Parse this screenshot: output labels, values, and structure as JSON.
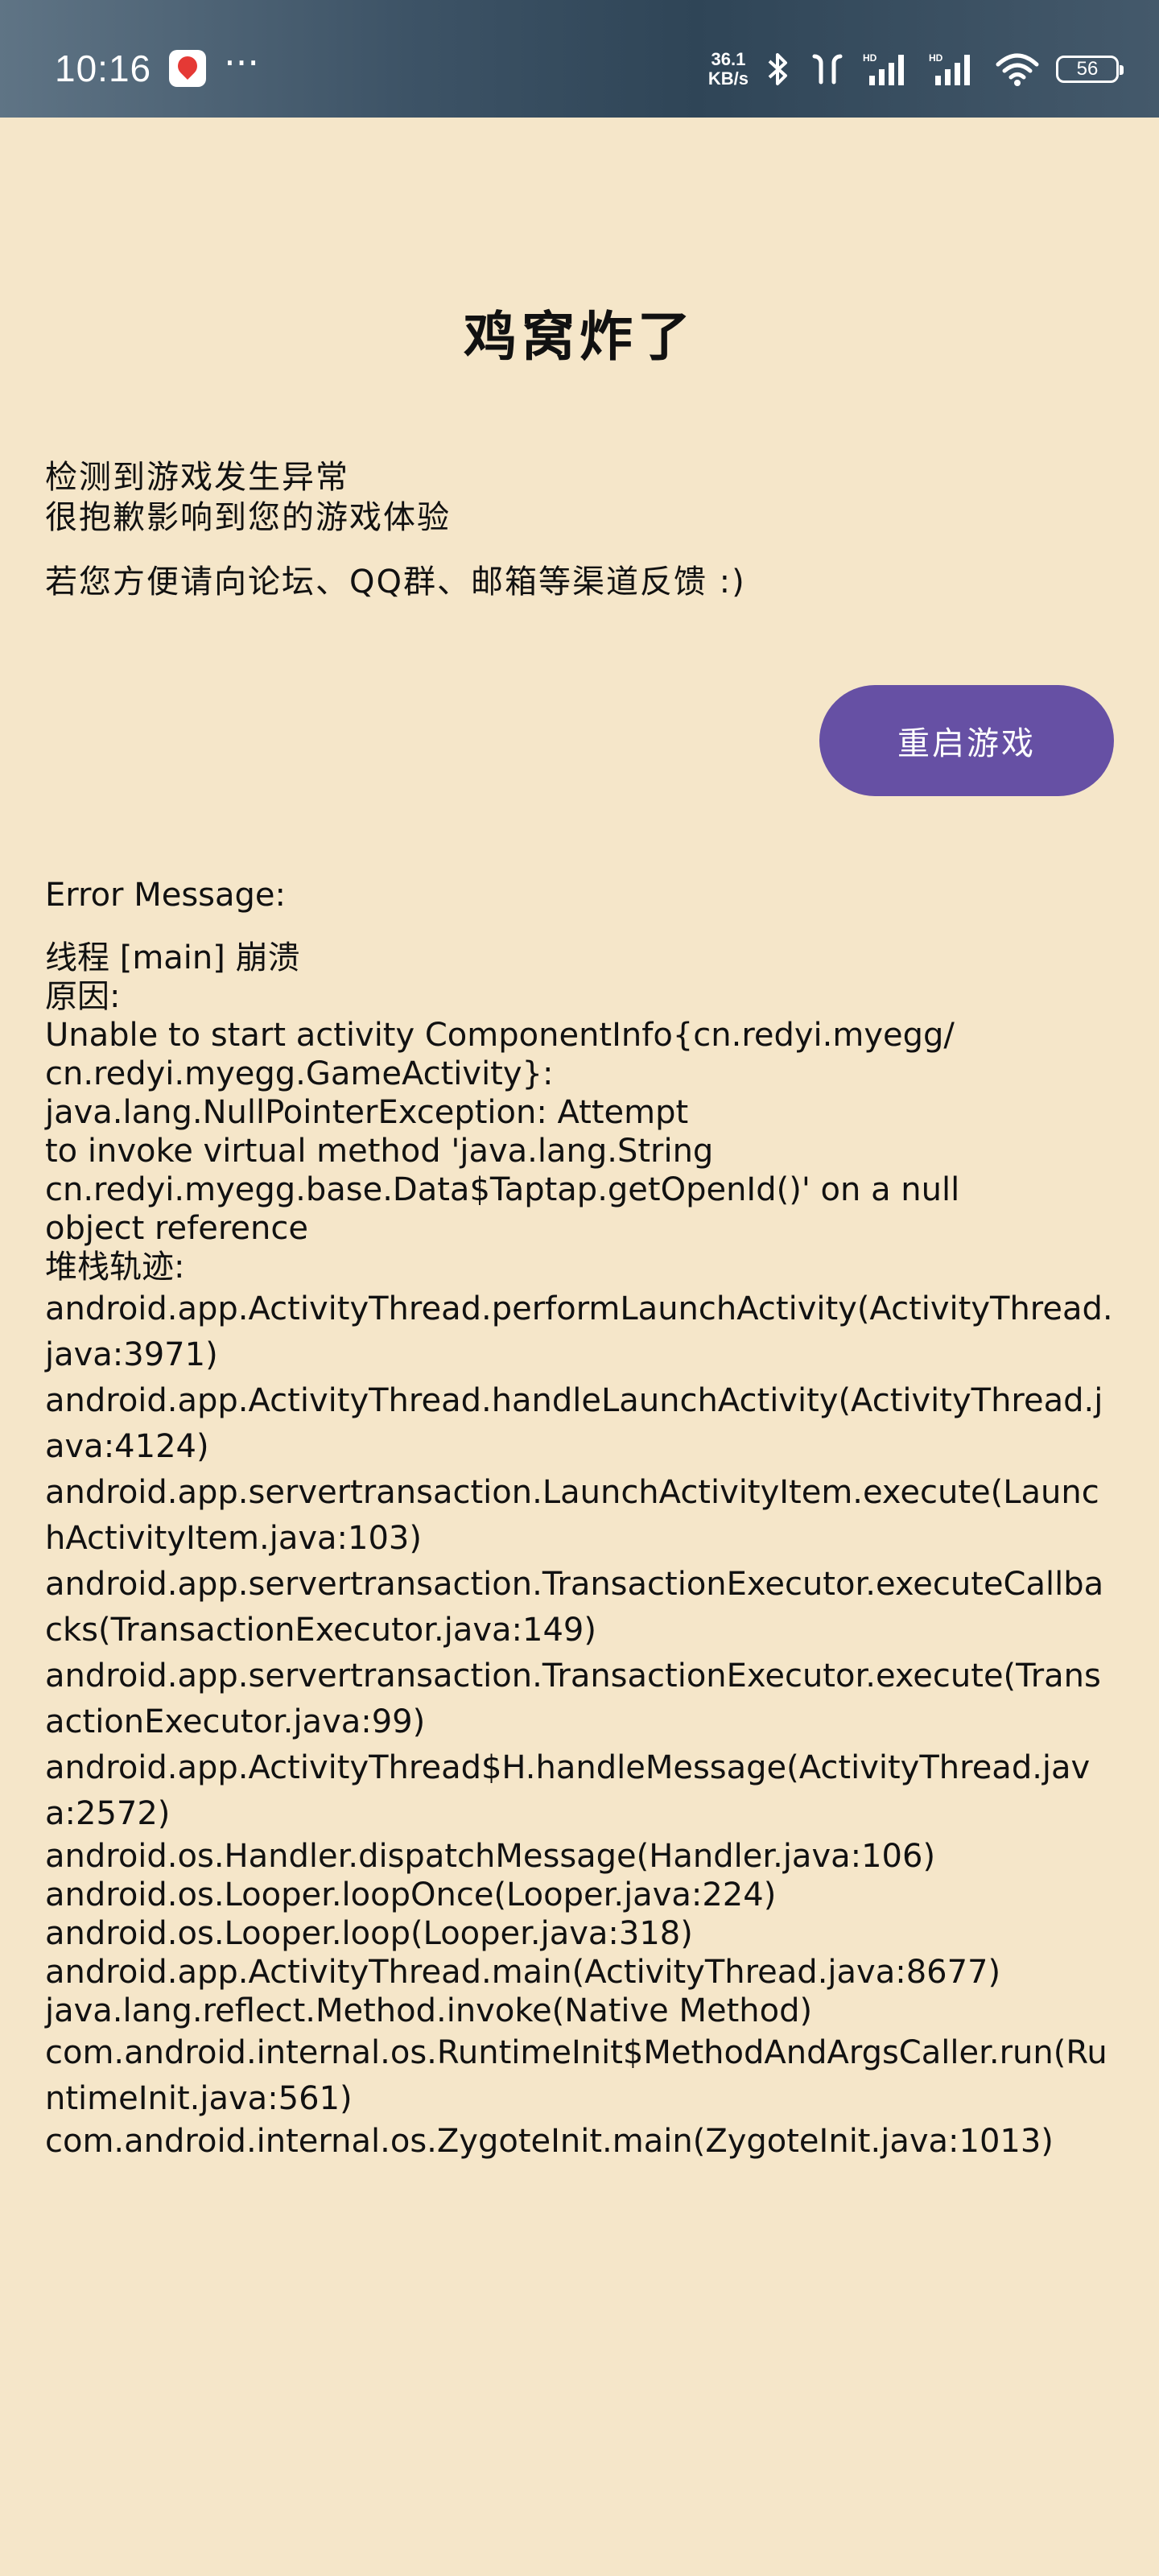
{
  "status_bar": {
    "time": "10:16",
    "more": "···",
    "net_speed_value": "36.1",
    "net_speed_unit": "KB/s",
    "battery": "56"
  },
  "title": "鸡窝炸了",
  "intro": {
    "line1": "检测到游戏发生异常",
    "line2": "很抱歉影响到您的游戏体验",
    "line3": "若您方便请向论坛、QQ群、邮箱等渠道反馈 :)"
  },
  "restart_button": "重启游戏",
  "error": {
    "label": "Error Message:",
    "thread_line": "线程 [main] 崩溃",
    "cause_label": "原因:",
    "cause_lines": [
      "Unable to start activity ComponentInfo{cn.redyi.myegg/",
      "cn.redyi.myegg.GameActivity}:",
      "java.lang.NullPointerException: Attempt",
      "to invoke virtual method 'java.lang.String",
      "cn.redyi.myegg.base.Data$Taptap.getOpenId()' on a null",
      "object reference"
    ],
    "stack_label": "堆栈轨迹:",
    "stack": [
      "android.app.ActivityThread.performLaunchActivity(ActivityThread.java:3971)",
      "android.app.ActivityThread.handleLaunchActivity(ActivityThread.java:4124)",
      "android.app.servertransaction.LaunchActivityItem.execute(LaunchActivityItem.java:103)",
      "android.app.servertransaction.TransactionExecutor.executeCallbacks(TransactionExecutor.java:149)",
      "android.app.servertransaction.TransactionExecutor.execute(TransactionExecutor.java:99)",
      "android.app.ActivityThread$H.handleMessage(ActivityThread.java:2572)",
      "android.os.Handler.dispatchMessage(Handler.java:106)",
      "android.os.Looper.loopOnce(Looper.java:224)",
      "android.os.Looper.loop(Looper.java:318)",
      "android.app.ActivityThread.main(ActivityThread.java:8677)",
      "java.lang.reflect.Method.invoke(Native Method)",
      "com.android.internal.os.RuntimeInit$MethodAndArgsCaller.run(RuntimeInit.java:561)",
      "com.android.internal.os.ZygoteInit.main(ZygoteInit.java:1013)"
    ]
  },
  "colors": {
    "background": "#f5e6c9",
    "button": "#6650a4",
    "button_text": "#ffffff"
  }
}
